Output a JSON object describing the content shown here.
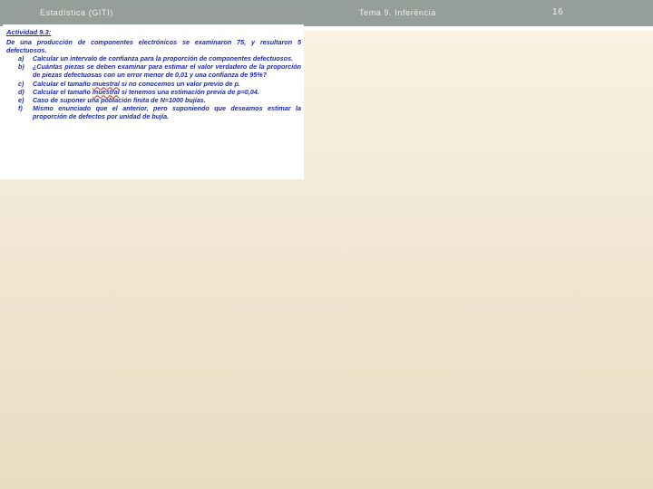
{
  "header": {
    "left": "Estadística (GITI)",
    "center": "Tema 9. Inferència",
    "page_number": "16"
  },
  "activity": {
    "title": "Actividad 9.3:",
    "intro": "De una producción de componentes electrónicos se examinaron 75, y resultaron 5 defectuosos.",
    "items": [
      {
        "letter": "a)",
        "text": "Calcular un intervalo de confianza para la proporción de componentes defectuosos."
      },
      {
        "letter": "b)",
        "text": "¿Cuántas piezas se deben examinar para estimar el valor verdadero de la proporción de piezas defectuosas con un error menor de 0,01 y una confianza de 95%?"
      },
      {
        "letter": "c)",
        "pre": "Calcular el tamaño ",
        "marked": "muestral",
        "post": " si no conocemos un valor previo de p."
      },
      {
        "letter": "d)",
        "pre": "Calcular el tamaño ",
        "marked": "muestral",
        "post": " si tenemos una estimación previa de p=0,04."
      },
      {
        "letter": "e)",
        "text": "Caso de suponer una población finita de N=1000 bujías."
      },
      {
        "letter": "f)",
        "text": "Mismo enunciado que el anterior, pero suponiendo que deseamos estimar la proporción de defectos por unidad de bujía."
      }
    ]
  },
  "colors": {
    "header_bg": "#959e98",
    "text_blue": "#1d2bb0",
    "bg_top": "#fcf3e4",
    "bg_bottom": "#e9dcc2"
  }
}
